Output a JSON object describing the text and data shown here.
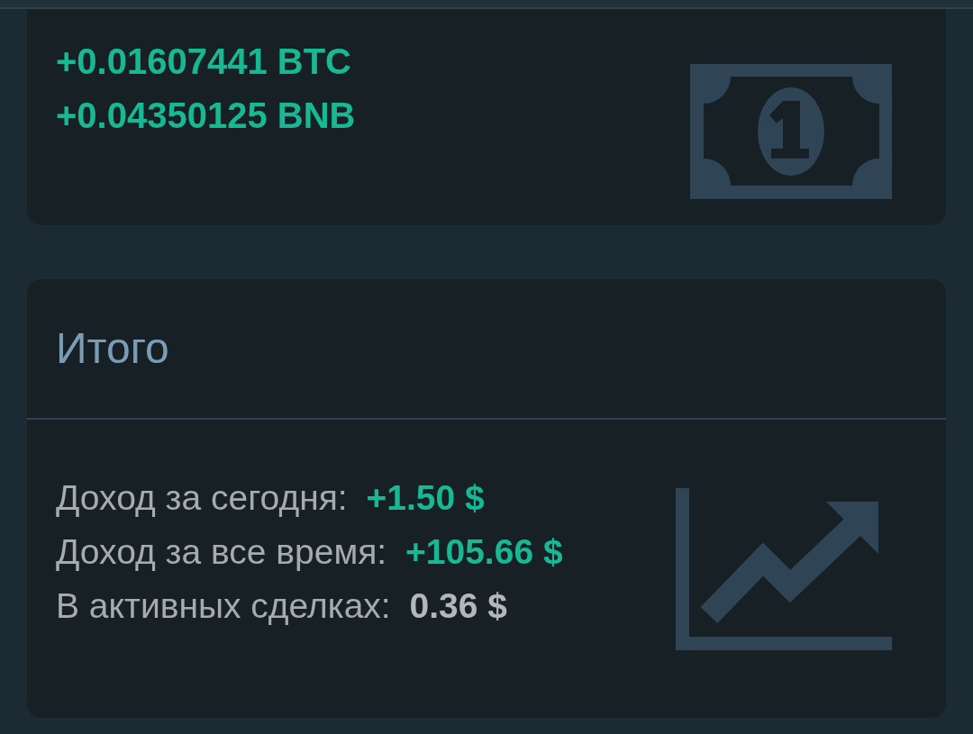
{
  "balance_card": {
    "amounts": [
      "+0.01607441 BTC",
      "+0.04350125 BNB"
    ]
  },
  "total_card": {
    "title": "Итого",
    "rows": [
      {
        "label": "Доход за сегодня:",
        "value": "+1.50 $",
        "positive": true
      },
      {
        "label": "Доход за все время:",
        "value": "+105.66 $",
        "positive": true
      },
      {
        "label": "В активных сделках:",
        "value": "0.36 $",
        "positive": false
      }
    ]
  }
}
